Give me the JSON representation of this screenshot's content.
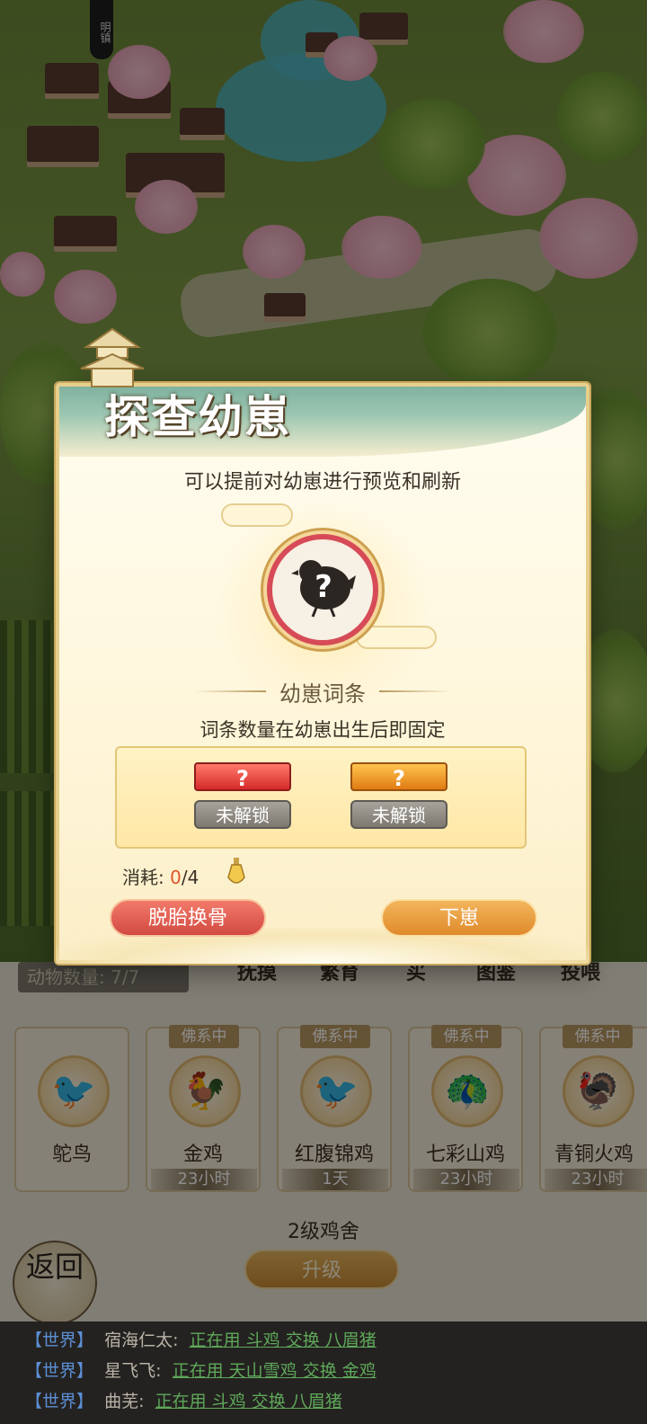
{
  "map": {
    "banner_text": "明镇"
  },
  "dialog": {
    "title": "探查幼崽",
    "subtitle": "可以提前对幼崽进行预览和刷新",
    "mystery_symbol": "?",
    "section_title": "幼崽词条",
    "section_desc": "词条数量在幼崽出生后即固定",
    "traits": [
      {
        "gem": "?",
        "lock_label": "未解锁",
        "color": "#d62a2a"
      },
      {
        "gem": "?",
        "lock_label": "未解锁",
        "color": "#e07b12"
      }
    ],
    "cost_label": "消耗:",
    "cost_current": "0",
    "cost_total": "/4",
    "cost_icon": "potion-bottle-icon",
    "buttons": {
      "reroll": "脱胎换骨",
      "hatch": "下崽"
    }
  },
  "panel": {
    "animal_count": "动物数量: 7/7",
    "tabs": [
      "抚摸",
      "繁育",
      "买",
      "图鉴",
      "投喂"
    ],
    "animals": [
      {
        "name": "鸵鸟",
        "tag": "",
        "time": "",
        "icon": "🐦"
      },
      {
        "name": "金鸡",
        "tag": "佛系中",
        "time": "23小时",
        "icon": "🐓"
      },
      {
        "name": "红腹锦鸡",
        "tag": "佛系中",
        "time": "1天",
        "icon": "🐦"
      },
      {
        "name": "七彩山鸡",
        "tag": "佛系中",
        "time": "23小时",
        "icon": "🦚"
      },
      {
        "name": "青铜火鸡",
        "tag": "佛系中",
        "time": "23小时",
        "icon": "🦃"
      }
    ],
    "coop_label": "2级鸡舍",
    "upgrade_label": "升级",
    "return_label": "返回"
  },
  "chat": [
    {
      "channel": "【世界】",
      "user": "宿海仁太:",
      "msg": "正在用 斗鸡 交换 八眉猪"
    },
    {
      "channel": "【世界】",
      "user": "星飞飞:",
      "msg": "正在用 天山雪鸡 交换 金鸡"
    },
    {
      "channel": "【世界】",
      "user": "曲芜:",
      "msg": "正在用 斗鸡 交换 八眉猪"
    }
  ]
}
